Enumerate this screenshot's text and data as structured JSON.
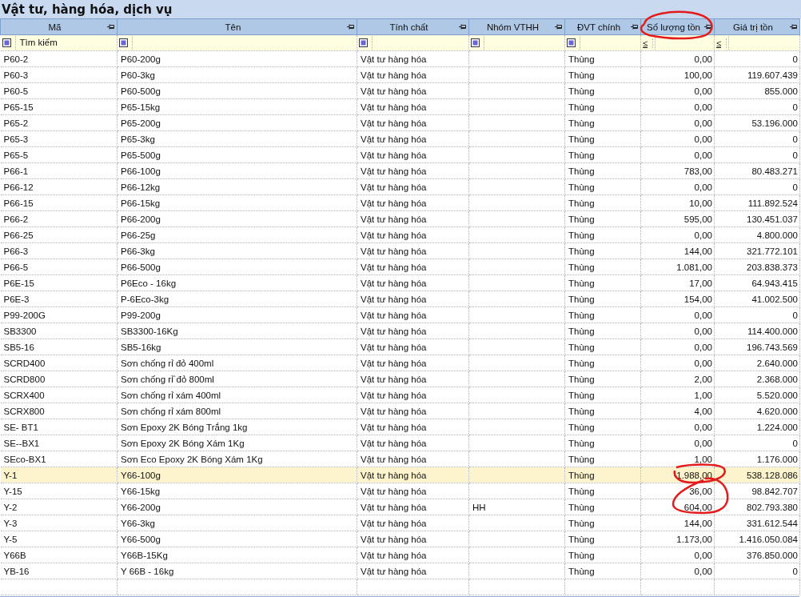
{
  "window": {
    "title": "Vật tư, hàng hóa, dịch vụ"
  },
  "table": {
    "columns": [
      {
        "label": "Mã"
      },
      {
        "label": "Tên"
      },
      {
        "label": "Tính chất"
      },
      {
        "label": "Nhóm VTHH"
      },
      {
        "label": "ĐVT chính"
      },
      {
        "label": "Số lượng tồn"
      },
      {
        "label": "Giá trị tồn"
      }
    ],
    "filters": [
      {
        "kind": "icon",
        "text": "Tìm kiếm"
      },
      {
        "kind": "icon"
      },
      {
        "kind": "icon"
      },
      {
        "kind": "icon"
      },
      {
        "kind": "icon"
      },
      {
        "kind": "operator",
        "text": "≤"
      },
      {
        "kind": "operator",
        "text": "≤"
      }
    ],
    "rows": [
      {
        "selected": false,
        "cells": [
          "P60-2",
          "P60-200g",
          "Vật tư hàng hóa",
          "",
          "Thùng",
          "0,00",
          "0"
        ]
      },
      {
        "selected": false,
        "cells": [
          "P60-3",
          "P60-3kg",
          "Vật tư hàng hóa",
          "",
          "Thùng",
          "100,00",
          "119.607.439"
        ]
      },
      {
        "selected": false,
        "cells": [
          "P60-5",
          "P60-500g",
          "Vật tư hàng hóa",
          "",
          "Thùng",
          "0,00",
          "855.000"
        ]
      },
      {
        "selected": false,
        "cells": [
          "P65-15",
          "P65-15kg",
          "Vật tư hàng hóa",
          "",
          "Thùng",
          "0,00",
          "0"
        ]
      },
      {
        "selected": false,
        "cells": [
          "P65-2",
          "P65-200g",
          "Vật tư hàng hóa",
          "",
          "Thùng",
          "0,00",
          "53.196.000"
        ]
      },
      {
        "selected": false,
        "cells": [
          "P65-3",
          "P65-3kg",
          "Vật tư hàng hóa",
          "",
          "Thùng",
          "0,00",
          "0"
        ]
      },
      {
        "selected": false,
        "cells": [
          "P65-5",
          "P65-500g",
          "Vật tư hàng hóa",
          "",
          "Thùng",
          "0,00",
          "0"
        ]
      },
      {
        "selected": false,
        "cells": [
          "P66-1",
          "P66-100g",
          "Vật tư hàng hóa",
          "",
          "Thùng",
          "783,00",
          "80.483.271"
        ]
      },
      {
        "selected": false,
        "cells": [
          "P66-12",
          "P66-12kg",
          "Vật tư hàng hóa",
          "",
          "Thùng",
          "0,00",
          "0"
        ]
      },
      {
        "selected": false,
        "cells": [
          "P66-15",
          "P66-15kg",
          "Vật tư hàng hóa",
          "",
          "Thùng",
          "10,00",
          "111.892.524"
        ]
      },
      {
        "selected": false,
        "cells": [
          "P66-2",
          "P66-200g",
          "Vật tư hàng hóa",
          "",
          "Thùng",
          "595,00",
          "130.451.037"
        ]
      },
      {
        "selected": false,
        "cells": [
          "P66-25",
          "P66-25g",
          "Vật tư hàng hóa",
          "",
          "Thùng",
          "0,00",
          "4.800.000"
        ]
      },
      {
        "selected": false,
        "cells": [
          "P66-3",
          "P66-3kg",
          "Vật tư hàng hóa",
          "",
          "Thùng",
          "144,00",
          "321.772.101"
        ]
      },
      {
        "selected": false,
        "cells": [
          "P66-5",
          "P66-500g",
          "Vật tư hàng hóa",
          "",
          "Thùng",
          "1.081,00",
          "203.838.373"
        ]
      },
      {
        "selected": false,
        "cells": [
          "P6E-15",
          "P6Eco - 16kg",
          "Vật tư hàng hóa",
          "",
          "Thùng",
          "17,00",
          "64.943.415"
        ]
      },
      {
        "selected": false,
        "cells": [
          "P6E-3",
          "P-6Eco-3kg",
          "Vật tư hàng hóa",
          "",
          "Thùng",
          "154,00",
          "41.002.500"
        ]
      },
      {
        "selected": false,
        "cells": [
          "P99-200G",
          "P99-200g",
          "Vật tư hàng hóa",
          "",
          "Thùng",
          "0,00",
          "0"
        ]
      },
      {
        "selected": false,
        "cells": [
          "SB3300",
          "SB3300-16Kg",
          "Vật tư hàng hóa",
          "",
          "Thùng",
          "0,00",
          "114.400.000"
        ]
      },
      {
        "selected": false,
        "cells": [
          "SB5-16",
          "SB5-16kg",
          "Vật tư hàng hóa",
          "",
          "Thùng",
          "0,00",
          "196.743.569"
        ]
      },
      {
        "selected": false,
        "cells": [
          "SCRD400",
          "Sơn chống rỉ đỏ 400ml",
          "Vật tư hàng hóa",
          "",
          "Thùng",
          "0,00",
          "2.640.000"
        ]
      },
      {
        "selected": false,
        "cells": [
          "SCRD800",
          "Sơn chống rỉ`đỏ 800ml",
          "Vật tư hàng hóa",
          "",
          "Thùng",
          "2,00",
          "2.368.000"
        ]
      },
      {
        "selected": false,
        "cells": [
          "SCRX400",
          "Sơn chống rỉ xám 400ml",
          "Vật tư hàng hóa",
          "",
          "Thùng",
          "1,00",
          "5.520.000"
        ]
      },
      {
        "selected": false,
        "cells": [
          "SCRX800",
          "Sơn chống rỉ xám 800ml",
          "Vật tư hàng hóa",
          "",
          "Thùng",
          "4,00",
          "4.620.000"
        ]
      },
      {
        "selected": false,
        "cells": [
          "SE- BT1",
          "Sơn Epoxy 2K Bóng Trắng 1kg",
          "Vật tư hàng hóa",
          "",
          "Thùng",
          "0,00",
          "1.224.000"
        ]
      },
      {
        "selected": false,
        "cells": [
          "SE--BX1",
          "Sơn Epoxy 2K Bóng Xám 1Kg",
          "Vật tư hàng hóa",
          "",
          "Thùng",
          "0,00",
          "0"
        ]
      },
      {
        "selected": false,
        "cells": [
          "SEco-BX1",
          "Sơn Eco Epoxy 2K Bóng Xám 1Kg",
          "Vật tư hàng hóa",
          "",
          "Thùng",
          "1,00",
          "1.176.000"
        ]
      },
      {
        "selected": true,
        "cells": [
          "Y-1",
          "Y66-100g",
          "Vật tư hàng hóa",
          "",
          "Thùng",
          "1.988,00",
          "538.128.086"
        ]
      },
      {
        "selected": false,
        "cells": [
          "Y-15",
          "Y66-15kg",
          "Vật tư hàng hóa",
          "",
          "Thùng",
          "36,00",
          "98.842.707"
        ]
      },
      {
        "selected": false,
        "cells": [
          "Y-2",
          "Y66-200g",
          "Vật tư hàng hóa",
          "HH",
          "Thùng",
          "604,00",
          "802.793.380"
        ]
      },
      {
        "selected": false,
        "cells": [
          "Y-3",
          "Y66-3kg",
          "Vật tư hàng hóa",
          "",
          "Thùng",
          "144,00",
          "331.612.544"
        ]
      },
      {
        "selected": false,
        "cells": [
          "Y-5",
          "Y66-500g",
          "Vật tư hàng hóa",
          "",
          "Thùng",
          "1.173,00",
          "1.416.050.084"
        ]
      },
      {
        "selected": false,
        "cells": [
          "Y66B",
          "Y66B-15Kg",
          "Vật tư hàng hóa",
          "",
          "Thùng",
          "0,00",
          "376.850.000"
        ]
      },
      {
        "selected": false,
        "cells": [
          "YB-16",
          "Y 66B - 16kg",
          "Vật tư hàng hóa",
          "",
          "Thùng",
          "0,00",
          "0"
        ]
      }
    ]
  }
}
